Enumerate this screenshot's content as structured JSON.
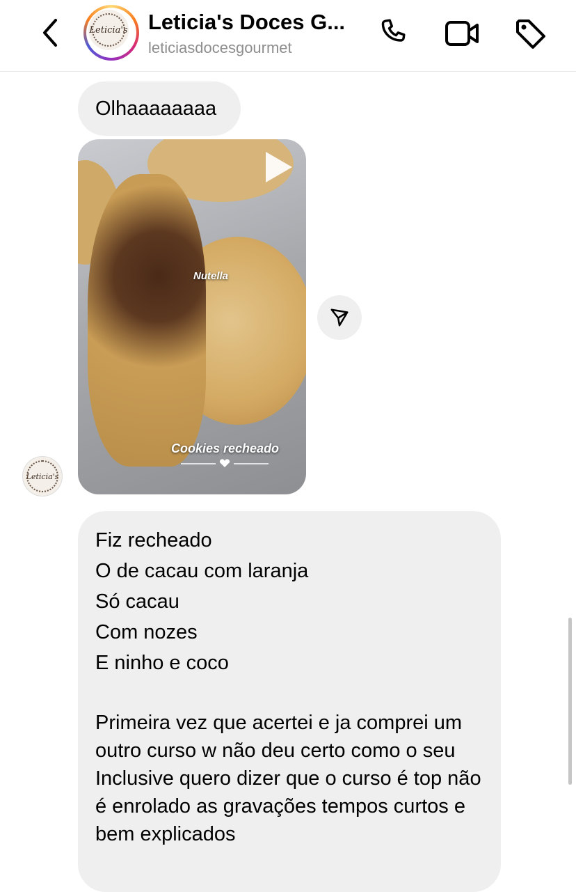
{
  "header": {
    "back_icon": "chevron-left-icon",
    "avatar_text": "Leticia's",
    "title": "Leticia's Doces G...",
    "username": "leticiasdocesgourmet",
    "call_icon": "phone-icon",
    "video_icon": "video-camera-icon",
    "tag_icon": "tag-icon"
  },
  "messages": [
    {
      "type": "text",
      "text": "Olhaaaaaaaa"
    },
    {
      "type": "video",
      "label_nutella": "Nutella",
      "label_caption": "Cookies recheado",
      "play_icon": "play-icon",
      "share_icon": "send-icon"
    },
    {
      "type": "text",
      "sender_avatar_text": "Leticia's",
      "lines": [
        "Fiz recheado",
        "O de cacau com laranja",
        "Só cacau",
        "Com nozes",
        "E ninho e coco"
      ],
      "paragraph_1": "Primeira vez que acertei e ja comprei um outro curso w não deu certo como o seu",
      "paragraph_2": "Inclusive quero dizer que o curso é top não é enrolado as gravações tempos curtos e bem explicados"
    }
  ],
  "colors": {
    "bubble": "#efefef",
    "subtitle": "#8e8e8e",
    "divider": "#e6e6e6"
  }
}
